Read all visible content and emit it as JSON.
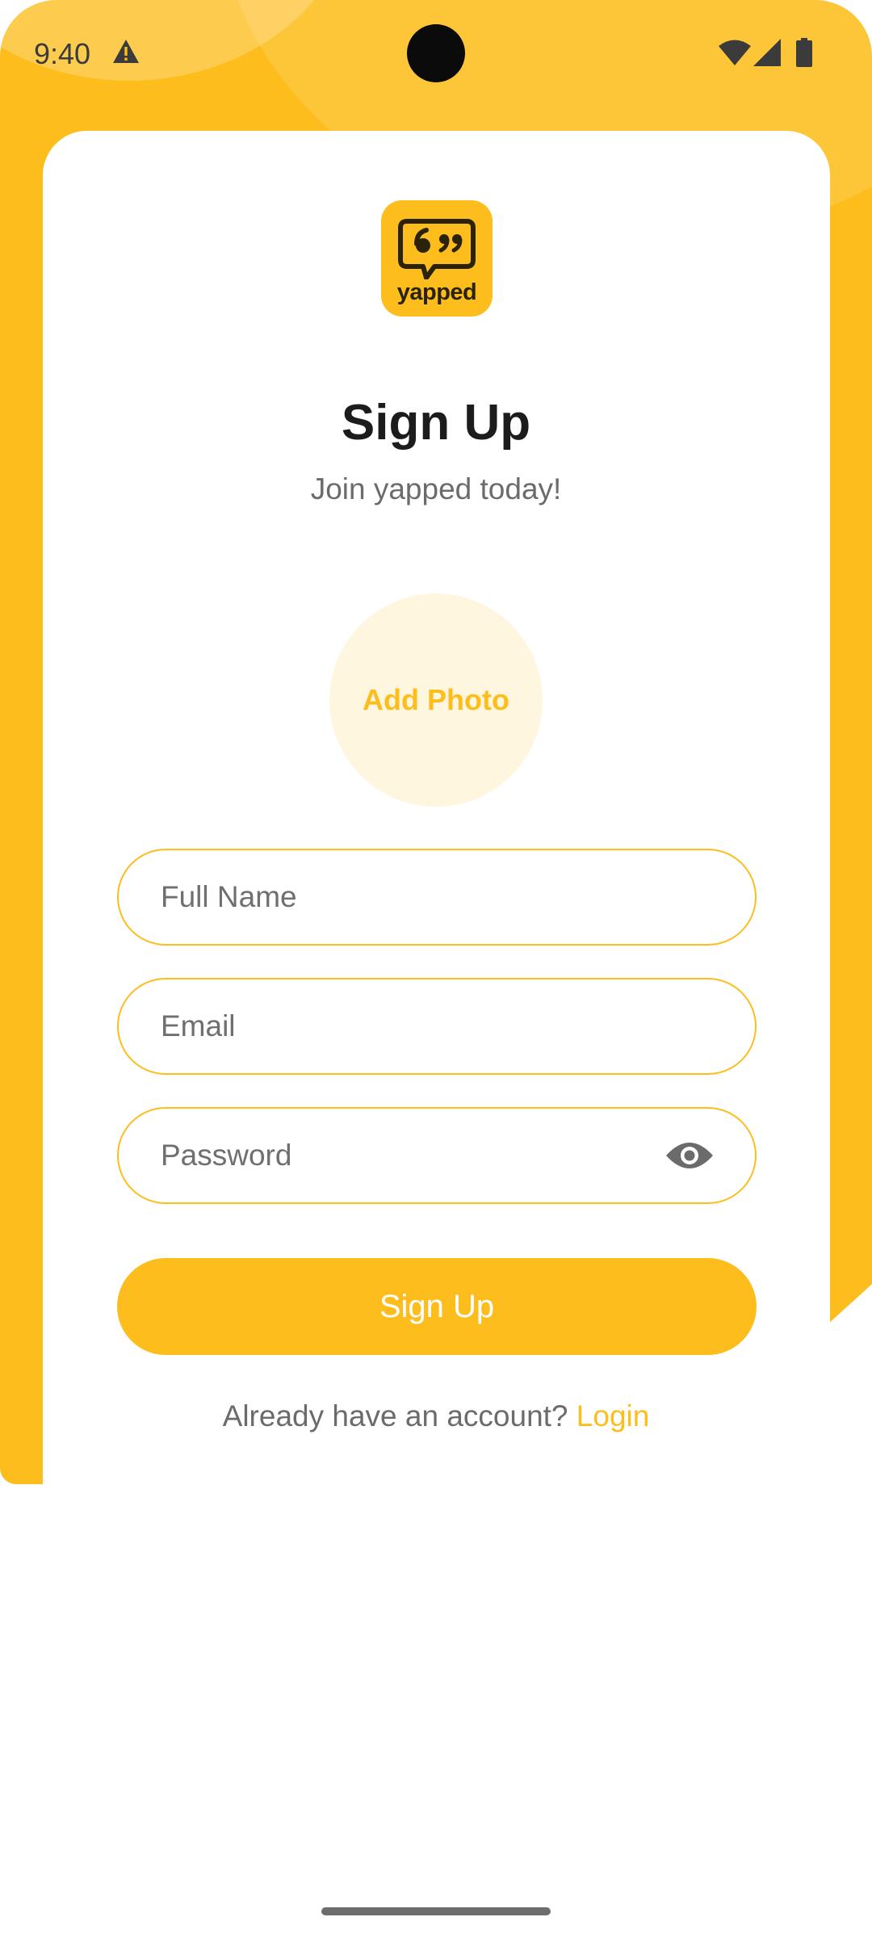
{
  "status_bar": {
    "time": "9:40",
    "icons": [
      "warning-icon",
      "wifi-icon",
      "signal-icon",
      "battery-icon"
    ]
  },
  "app": {
    "logo_text": "yapped",
    "logo_icon": "quote-bubble-icon"
  },
  "header": {
    "title": "Sign Up",
    "subtitle": "Join yapped today!"
  },
  "photo": {
    "label": "Add Photo"
  },
  "form": {
    "full_name_placeholder": "Full Name",
    "email_placeholder": "Email",
    "password_placeholder": "Password",
    "password_toggle_icon": "eye-icon",
    "submit_label": "Sign Up"
  },
  "footer": {
    "prompt": "Already have an account?",
    "link_label": "Login"
  },
  "colors": {
    "accent": "#FDBE1D",
    "photo_bg": "#FFF6E0",
    "title": "#1c1c1c",
    "muted": "#6b6b6b"
  }
}
